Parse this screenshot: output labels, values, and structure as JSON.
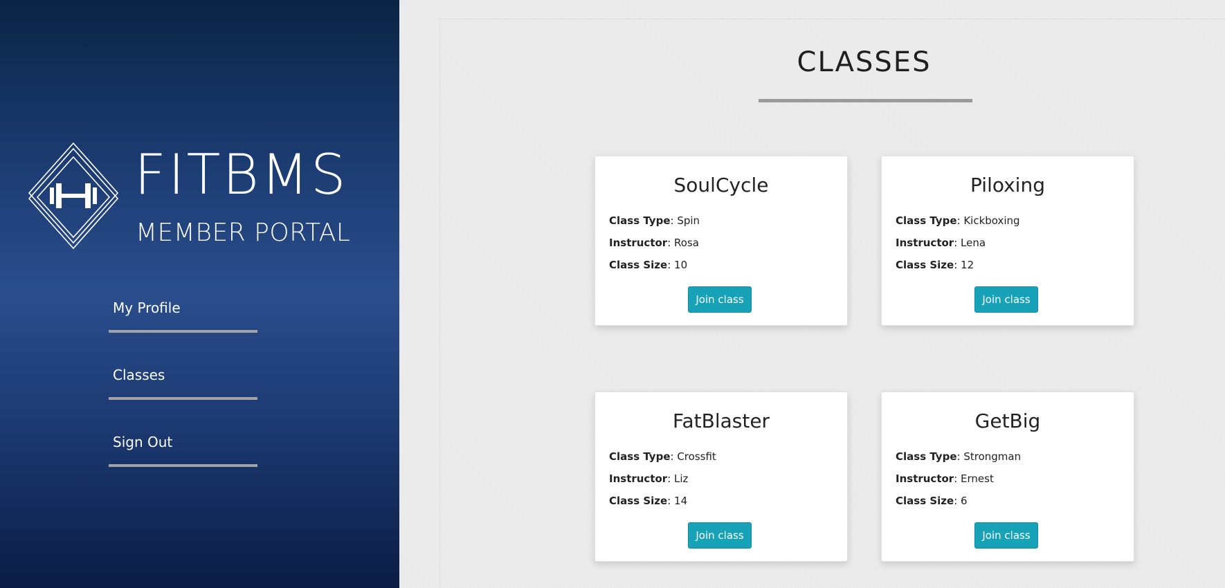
{
  "brand": {
    "title": "FITBMS",
    "subtitle": "MEMBER PORTAL",
    "logo_icon": "dumbbell-diamond-icon"
  },
  "nav": {
    "items": [
      {
        "label": "My Profile"
      },
      {
        "label": "Classes"
      },
      {
        "label": "Sign Out"
      }
    ]
  },
  "page": {
    "title": "CLASSES"
  },
  "labels": {
    "class_type": "Class Type",
    "instructor": "Instructor",
    "class_size": "Class Size",
    "join_button": "Join class"
  },
  "classes": [
    {
      "name": "SoulCycle",
      "class_type": "Spin",
      "instructor": "Rosa",
      "class_size": "10"
    },
    {
      "name": "Piloxing",
      "class_type": "Kickboxing",
      "instructor": "Lena",
      "class_size": "12"
    },
    {
      "name": "FatBlaster",
      "class_type": "Crossfit",
      "instructor": "Liz",
      "class_size": "14"
    },
    {
      "name": "GetBig",
      "class_type": "Strongman",
      "instructor": "Ernest",
      "class_size": "6"
    }
  ],
  "colors": {
    "accent": "#17a2b8",
    "sidebar_top": "#0a2444",
    "sidebar_mid": "#2a4d8c",
    "underline": "#a3a3a3"
  }
}
